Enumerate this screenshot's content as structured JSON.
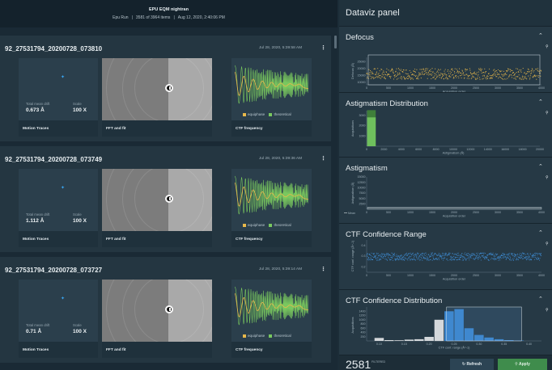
{
  "header": {
    "title": "EPU EQM nightran",
    "run": "Epu Run",
    "items": "3581 of 3964 items",
    "datetime": "Aug 12, 2020, 2:40:06 PM"
  },
  "cards": [
    {
      "name": "92_27531794_20200728_073810",
      "date": "Jul 28, 2020, 5:39:58 AM",
      "drift_label": "Total mean drift",
      "drift": "0.673 Å",
      "scale_label": "Scale",
      "scale": "100 X",
      "motion_label": "Motion Traces",
      "fft_label": "FFT and fit",
      "ctf_label": "CTF frequency",
      "legend_a": "equiphase",
      "legend_b": "theoretical"
    },
    {
      "name": "92_27531794_20200728_073749",
      "date": "Jul 28, 2020, 5:39:36 AM",
      "drift_label": "Total mean drift",
      "drift": "1.112 Å",
      "scale_label": "Scale",
      "scale": "100 X",
      "motion_label": "Motion Traces",
      "fft_label": "FFT and fit",
      "ctf_label": "CTF frequency",
      "legend_a": "equiphase",
      "legend_b": "theoretical"
    },
    {
      "name": "92_27531794_20200728_073727",
      "date": "Jul 28, 2020, 5:39:14 AM",
      "drift_label": "Total mean drift",
      "drift": "0.71 Å",
      "scale_label": "Scale",
      "scale": "100 X",
      "motion_label": "Motion Traces",
      "fft_label": "FFT and fit",
      "ctf_label": "CTF frequency",
      "legend_a": "equiphase",
      "legend_b": "theoretical"
    }
  ],
  "panel": {
    "title": "Dataviz panel",
    "sections": [
      {
        "title": "Defocus"
      },
      {
        "title": "Astigmatism Distribution"
      },
      {
        "title": "Astigmatism"
      },
      {
        "title": "CTF Confidence Range"
      },
      {
        "title": "CTF Confidence Distribution"
      }
    ]
  },
  "footer": {
    "count": "2581",
    "filtered_label": "FILTERED",
    "refresh": "Refresh",
    "apply": "Apply"
  },
  "icons": {
    "caret": "chevron-up-icon",
    "filter": "filter-icon",
    "menu": "kebab-menu-icon"
  },
  "chart_data": [
    {
      "type": "scatter",
      "title": "Defocus",
      "xlabel": "Acquisition order",
      "ylabel": "Defocus (Å)",
      "x_ticks": [
        0,
        500,
        1000,
        1500,
        2000,
        2500,
        3000,
        3500,
        4000
      ],
      "y_ticks": [
        10000,
        15000,
        20000,
        25000
      ],
      "xlim": [
        0,
        4000
      ],
      "ylim": [
        8000,
        28000
      ],
      "series": [
        {
          "color": "#e8b84b",
          "y_range": [
            12000,
            20000
          ]
        }
      ]
    },
    {
      "type": "bar",
      "title": "Astigmatism Distribution",
      "xlabel": "Astigmatism (Å)",
      "ylabel": "Acquisitions",
      "x_ticks": [
        0,
        2000,
        4000,
        6000,
        8000,
        10000,
        12000,
        14000,
        16000,
        18000,
        20000
      ],
      "y_ticks": [
        1000,
        2000,
        3000
      ],
      "bins": [
        {
          "x": [
            0,
            1000
          ],
          "values": [
            3500,
            2800
          ]
        }
      ]
    },
    {
      "type": "line",
      "title": "Astigmatism",
      "xlabel": "Acquisition order",
      "ylabel": "Astigmatism (Å)",
      "legend": [
        "Mean"
      ],
      "x_ticks": [
        0,
        500,
        1000,
        1500,
        2000,
        2500,
        3000,
        3500,
        4000
      ],
      "y_ticks": [
        2500,
        5000,
        7500,
        10000,
        12500,
        15000
      ],
      "ylim": [
        0,
        15000
      ]
    },
    {
      "type": "scatter",
      "title": "CTF Confidence Range",
      "xlabel": "Acquisition order",
      "ylabel": "CTF conf. range (Å^-1)",
      "x_ticks": [
        0,
        500,
        1000,
        1500,
        2000,
        2500,
        3000,
        3500,
        4000
      ],
      "y_ticks": [
        0.2,
        0.3,
        0.4
      ],
      "ylim": [
        0.15,
        0.45
      ],
      "series": [
        {
          "color": "#3f8fd8",
          "y_range": [
            0.26,
            0.33
          ]
        }
      ]
    },
    {
      "type": "bar",
      "title": "CTF Confidence Distribution",
      "xlabel": "CTF conf. range (Å^-1)",
      "ylabel": "Acquisitions",
      "categories": [
        "0.10",
        "0.12",
        "0.14",
        "0.16",
        "0.18",
        "0.20",
        "0.22",
        "0.24",
        "0.26",
        "0.28",
        "0.30",
        "0.32",
        "0.34",
        "0.36",
        "0.38"
      ],
      "values": [
        140,
        40,
        30,
        60,
        80,
        190,
        1000,
        1400,
        1500,
        600,
        280,
        160,
        80,
        40,
        20
      ],
      "x_ticks": [
        "0.10",
        "0.15",
        "0.20",
        "0.25",
        "0.30",
        "0.35",
        "0.40"
      ],
      "y_ticks": [
        200,
        400,
        600,
        800,
        1000,
        1200,
        1400
      ],
      "selected_range": [
        0.235,
        0.385
      ]
    }
  ]
}
